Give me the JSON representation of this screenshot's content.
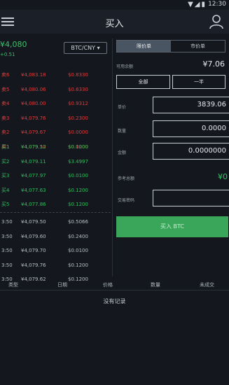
{
  "status": {
    "time": "12:30"
  },
  "header": {
    "title": "买入"
  },
  "ticker": {
    "price": "¥4,080",
    "change": "+0.51",
    "pair": "BTC/CNY ▾"
  },
  "asks": [
    {
      "label": "卖6",
      "price": "¥4,083.18",
      "amount": "$0.8330"
    },
    {
      "label": "卖5",
      "price": "¥4,080.06",
      "amount": "$0.6330"
    },
    {
      "label": "卖4",
      "price": "¥4,080.00",
      "amount": "$0.9312"
    },
    {
      "label": "卖3",
      "price": "¥4,079.76",
      "amount": "$0.2300"
    },
    {
      "label": "卖2",
      "price": "¥4,079.67",
      "amount": "$0.0000"
    },
    {
      "label": "卖1",
      "price": "¥4,079.50",
      "amount": "$0.1200"
    }
  ],
  "bids": [
    {
      "label": "买1",
      "price": "¥4,079.12",
      "amount": "$0.0000"
    },
    {
      "label": "买2",
      "price": "¥4,079.11",
      "amount": "$3.4997"
    },
    {
      "label": "买3",
      "price": "¥4,077.97",
      "amount": "$0.0100"
    },
    {
      "label": "买4",
      "price": "¥4,077.63",
      "amount": "$0.1200"
    },
    {
      "label": "买5",
      "price": "¥4,077.86",
      "amount": "$0.1200"
    }
  ],
  "trades": [
    {
      "time": "3:50",
      "price": "¥4,079.50",
      "amount": "$0.5066"
    },
    {
      "time": "3:50",
      "price": "¥4,079.60",
      "amount": "$0.2400"
    },
    {
      "time": "3:50",
      "price": "¥4,079.70",
      "amount": "$0.0100"
    },
    {
      "time": "3:50",
      "price": "¥4,079.76",
      "amount": "$0.1200"
    },
    {
      "time": "3:50",
      "price": "¥4,079.62",
      "amount": "$0.1200"
    }
  ],
  "order": {
    "tab_limit": "限价单",
    "tab_market": "市价单",
    "available_label": "可用余额",
    "available_value": "¥7.06",
    "all_button": "全部",
    "half_button": "一半",
    "price_label": "单价",
    "price_value": "3839.06",
    "qty_label": "数量",
    "qty_value": "0.0000",
    "amount_label": "金额",
    "amount_value": "0.0000000",
    "est_label": "参考总额",
    "est_value": "¥0",
    "pwd_label": "交易密码",
    "buy_button": "买入 BTC"
  },
  "history": {
    "columns": [
      "类型",
      "日期",
      "价格",
      "数量",
      "未成交"
    ],
    "empty": "没有记录"
  }
}
